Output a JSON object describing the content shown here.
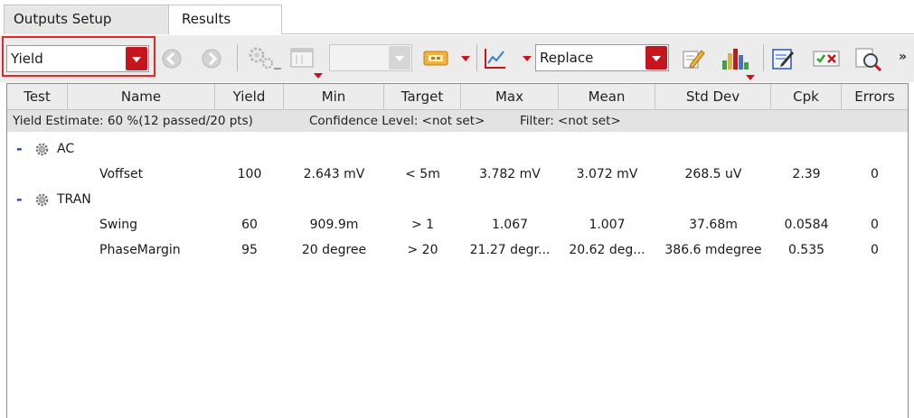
{
  "tabs": [
    {
      "label": "Outputs Setup",
      "active": false
    },
    {
      "label": "Results",
      "active": true
    }
  ],
  "toolbar": {
    "view_select": {
      "value": "Yield"
    },
    "disabled_select": {
      "value": ""
    },
    "mode_select": {
      "value": "Replace"
    },
    "more_glyph": "»",
    "icons": [
      "back-icon",
      "forward-icon",
      "settings-icon",
      "layout-window-icon",
      "expression-icon",
      "plot-icon",
      "edit-notes-icon",
      "histogram-icon",
      "edit-icon",
      "pass-fail-icon",
      "inspect-icon"
    ]
  },
  "table": {
    "columns": [
      "Test",
      "Name",
      "Yield",
      "Min",
      "Target",
      "Max",
      "Mean",
      "Std Dev",
      "Cpk",
      "Errors"
    ],
    "summary": {
      "yield": "Yield Estimate: 60 %(12 passed/20 pts)",
      "confidence": "Confidence Level: <not set>",
      "filter": "Filter: <not set>"
    },
    "groups": [
      {
        "expander": "-",
        "label": "AC",
        "rows": [
          {
            "name": "Voffset",
            "yield": "100",
            "min": "2.643 mV",
            "target": "< 5m",
            "max": "3.782 mV",
            "mean": "3.072 mV",
            "std_dev": "268.5 uV",
            "cpk": "2.39",
            "errors": "0"
          }
        ]
      },
      {
        "expander": "-",
        "label": "TRAN",
        "rows": [
          {
            "name": "Swing",
            "yield": "60",
            "min": "909.9m",
            "target": "> 1",
            "max": "1.067",
            "mean": "1.007",
            "std_dev": "37.68m",
            "cpk": "0.0584",
            "errors": "0"
          },
          {
            "name": "PhaseMargin",
            "yield": "95",
            "min": "20 degree",
            "target": "> 20",
            "max": "21.27 degr...",
            "mean": "20.62 deg...",
            "std_dev": "386.6 mdegree",
            "cpk": "0.535",
            "errors": "0"
          }
        ]
      }
    ]
  },
  "colors": {
    "accent_red": "#c7151e",
    "highlight_box": "#e3262b",
    "expander_blue": "#1d3fa8"
  }
}
